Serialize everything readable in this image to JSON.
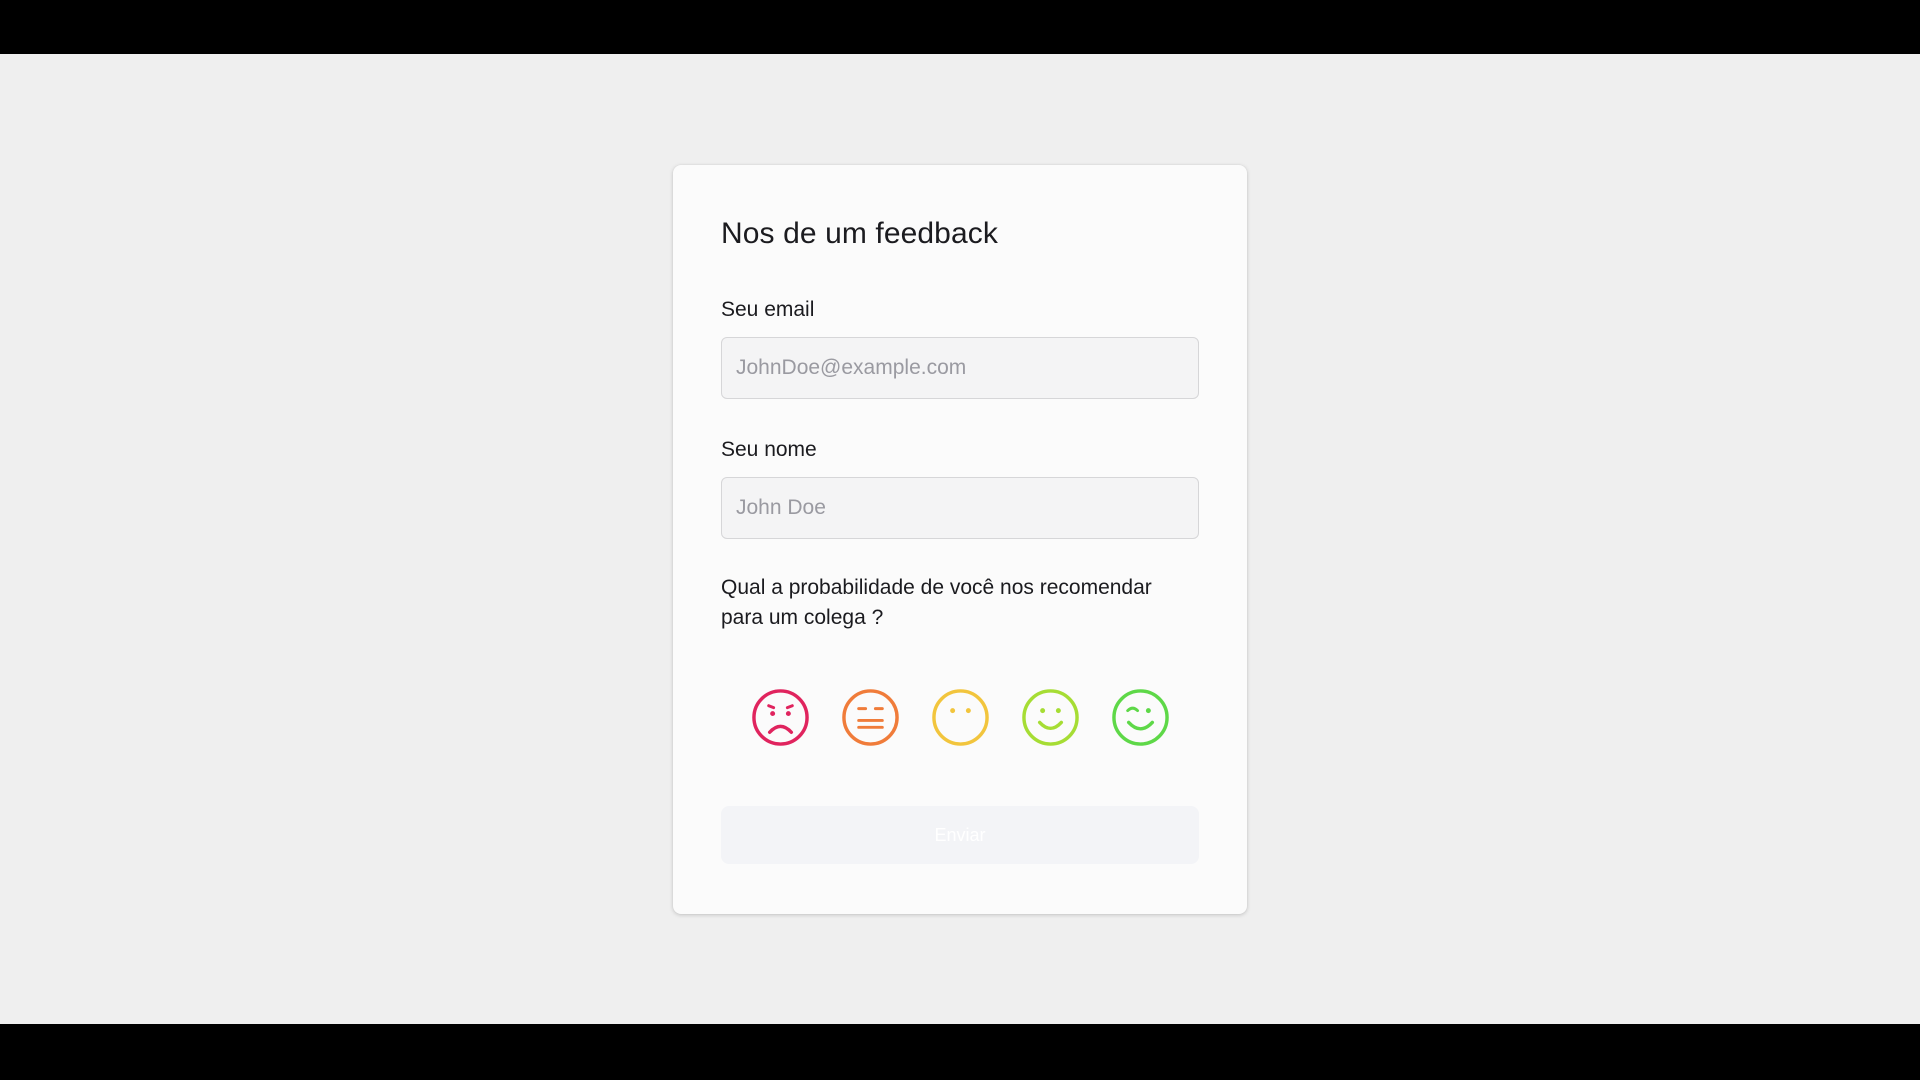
{
  "form": {
    "title": "Nos de um feedback",
    "email": {
      "label": "Seu email",
      "placeholder": "JohnDoe@example.com",
      "value": ""
    },
    "name": {
      "label": "Seu nome",
      "placeholder": "John Doe",
      "value": ""
    },
    "question": "Qual a probabilidade de você nos recomendar para um colega ?",
    "ratings": [
      {
        "icon": "very-sad-face-icon",
        "color": "#e0245e"
      },
      {
        "icon": "neutral-face-icon",
        "color": "#f07c3a"
      },
      {
        "icon": "slight-face-icon",
        "color": "#f2c53d"
      },
      {
        "icon": "smile-face-icon",
        "color": "#a6dd34"
      },
      {
        "icon": "wink-face-icon",
        "color": "#5ed848"
      }
    ],
    "submit_label": "Enviar",
    "submit_enabled": false
  },
  "colors": {
    "background": "#efefef",
    "card": "#fbfbfb",
    "text": "#1b1b1f"
  }
}
